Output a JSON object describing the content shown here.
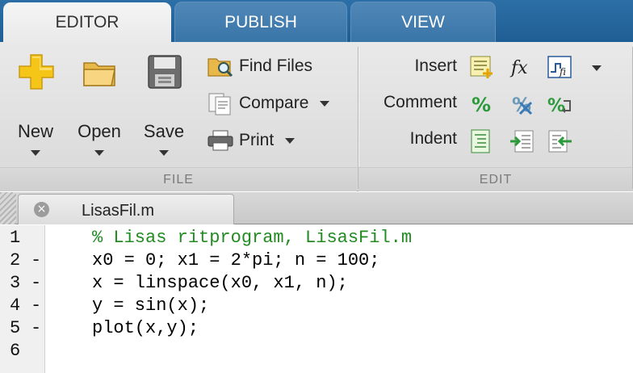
{
  "tabs": [
    {
      "label": "EDITOR",
      "active": true
    },
    {
      "label": "PUBLISH",
      "active": false
    },
    {
      "label": "VIEW",
      "active": false
    }
  ],
  "file_section": {
    "title": "FILE",
    "new_label": "New",
    "open_label": "Open",
    "save_label": "Save",
    "find_files_label": "Find Files",
    "compare_label": "Compare",
    "print_label": "Print"
  },
  "edit_section": {
    "title": "EDIT",
    "insert_label": "Insert",
    "comment_label": "Comment",
    "indent_label": "Indent",
    "fx_glyph": "fx",
    "percent_glyph": "%"
  },
  "document": {
    "filename": "LisasFil.m",
    "close_glyph": "×"
  },
  "code_lines": [
    {
      "number": "1",
      "marker": "",
      "text": "% Lisas ritprogram, LisasFil.m",
      "is_comment": true
    },
    {
      "number": "2",
      "marker": "-",
      "text": "x0 = 0; x1 = 2*pi; n = 100;",
      "is_comment": false
    },
    {
      "number": "3",
      "marker": "-",
      "text": "x = linspace(x0, x1, n);",
      "is_comment": false
    },
    {
      "number": "4",
      "marker": "-",
      "text": "y = sin(x);",
      "is_comment": false
    },
    {
      "number": "5",
      "marker": "-",
      "text": "plot(x,y);",
      "is_comment": false
    },
    {
      "number": "6",
      "marker": "",
      "text": "",
      "is_comment": false
    }
  ],
  "colors": {
    "tab_bar_blue": "#2c6fa6",
    "comment_green": "#228b22",
    "new_icon_yellow": "#f5c518"
  }
}
